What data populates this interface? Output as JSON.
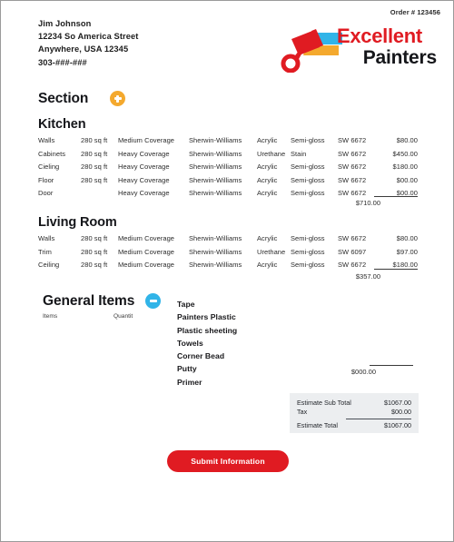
{
  "order": {
    "label": "Order # 123456"
  },
  "customer": {
    "name": "Jim Johnson",
    "address_line1": "12234 So America Street",
    "address_line2": "Anywhere, USA 12345",
    "phone": "303-###-###"
  },
  "logo": {
    "line1": "Excellent",
    "line2": "Painters",
    "line1_color": "#e01b22",
    "line2_color": "#15161a",
    "roller_color": "#e01b22",
    "stroke_cyan": "#31b4e8",
    "stroke_orange": "#f4a92e"
  },
  "section": {
    "title": "Section",
    "add_button_color": "#f4a92e",
    "add_icon": "plus-icon"
  },
  "rooms": [
    {
      "title": "Kitchen",
      "rows": [
        {
          "surface": "Walls",
          "area": "280 sq ft",
          "coverage": "Medium Coverage",
          "brand": "Sherwin-Williams",
          "type": "Acrylic",
          "finish": "Semi-gloss",
          "code": "SW 6672",
          "price": "$80.00"
        },
        {
          "surface": "Cabinets",
          "area": "280 sq ft",
          "coverage": "Heavy Coverage",
          "brand": "Sherwin-Williams",
          "type": "Urethane",
          "finish": "Stain",
          "code": "SW 6672",
          "price": "$450.00"
        },
        {
          "surface": "Cieling",
          "area": "280 sq ft",
          "coverage": "Heavy Coverage",
          "brand": "Sherwin-Williams",
          "type": "Acrylic",
          "finish": "Semi-gloss",
          "code": "SW 6672",
          "price": "$180.00"
        },
        {
          "surface": "Floor",
          "area": "280 sq ft",
          "coverage": "Heavy Coverage",
          "brand": "Sherwin-Williams",
          "type": "Acrylic",
          "finish": "Semi-gloss",
          "code": "SW 6672",
          "price": "$00.00"
        },
        {
          "surface": "Door",
          "area": "",
          "coverage": "Heavy Coverage",
          "brand": "Sherwin-Williams",
          "type": "Acrylic",
          "finish": "Semi-gloss",
          "code": "SW 6672",
          "price": "$00.00"
        }
      ],
      "subtotal": "$710.00"
    },
    {
      "title": "Living Room",
      "rows": [
        {
          "surface": "Walls",
          "area": "280 sq ft",
          "coverage": "Medium Coverage",
          "brand": "Sherwin-Williams",
          "type": "Acrylic",
          "finish": "Semi-gloss",
          "code": "SW 6672",
          "price": "$80.00"
        },
        {
          "surface": "Trim",
          "area": "280 sq ft",
          "coverage": "Medium Coverage",
          "brand": "Sherwin-Williams",
          "type": "Urethane",
          "finish": "Semi-gloss",
          "code": "SW 6097",
          "price": "$97.00"
        },
        {
          "surface": "Ceiling",
          "area": "280 sq ft",
          "coverage": "Medium Coverage",
          "brand": "Sherwin-Williams",
          "type": "Acrylic",
          "finish": "Semi-gloss",
          "code": "SW 6672",
          "price": "$180.00"
        }
      ],
      "subtotal": "$357.00"
    }
  ],
  "general_items": {
    "title": "General Items",
    "remove_button_color": "#31b4e8",
    "remove_icon": "minus-icon",
    "col_items": "Items",
    "col_quantity": "Quantit",
    "items": [
      "Tape",
      "Painters Plastic",
      "Plastic sheeting",
      "Towels",
      "Corner Bead",
      "Putty",
      "Primer"
    ],
    "subtotal": "$000.00"
  },
  "totals": {
    "subtotal_label": "Estimate Sub Total",
    "subtotal_value": "$1067.00",
    "tax_label": "Tax",
    "tax_value": "$00.00",
    "total_label": "Estimate Total",
    "total_value": "$1067.00"
  },
  "submit": {
    "label": "Submit Information",
    "color": "#e01b22"
  }
}
